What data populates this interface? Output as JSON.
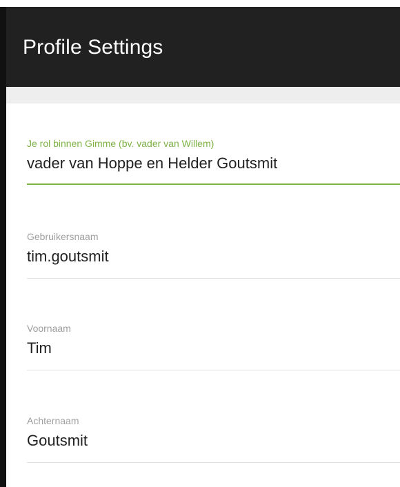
{
  "header": {
    "title": "Profile Settings"
  },
  "form": {
    "fields": [
      {
        "label": "Je rol binnen Gimme (bv. vader van Willem)",
        "value": "vader van Hoppe en Helder Goutsmit",
        "focused": true
      },
      {
        "label": "Gebruikersnaam",
        "value": "tim.goutsmit",
        "focused": false
      },
      {
        "label": "Voornaam",
        "value": "Tim",
        "focused": false
      },
      {
        "label": "Achternaam",
        "value": "Goutsmit",
        "focused": false
      }
    ]
  },
  "colors": {
    "header_bg": "#212121",
    "accent": "#7cb342",
    "label_inactive": "#9e9e9e",
    "underline_inactive": "#e0e0e0"
  }
}
